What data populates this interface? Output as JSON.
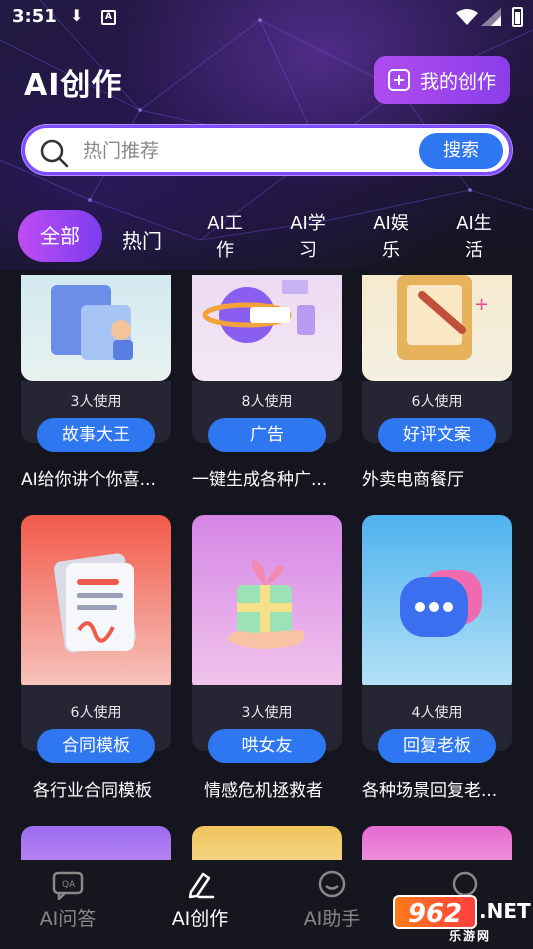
{
  "status_bar": {
    "time": "3:51"
  },
  "header": {
    "title": "AI创作",
    "my_button_label": "我的创作"
  },
  "search": {
    "placeholder": "热门推荐",
    "button_label": "搜索"
  },
  "tabs": [
    {
      "label": "全部",
      "active": true
    },
    {
      "label": "热门"
    },
    {
      "line1": "AI工",
      "line2": "作"
    },
    {
      "line1": "AI学",
      "line2": "习"
    },
    {
      "line1": "AI娱",
      "line2": "乐"
    },
    {
      "line1": "AI生",
      "line2": "活"
    }
  ],
  "cards": [
    {
      "usage": "3人使用",
      "tag": "故事大王",
      "desc": "AI给你讲个你喜...",
      "colors": [
        "#c9e6f0",
        "#e8f2f0"
      ]
    },
    {
      "usage": "8人使用",
      "tag": "广告",
      "desc": "一键生成各种广...",
      "colors": [
        "#e9d4f2",
        "#f4e8f4"
      ]
    },
    {
      "usage": "6人使用",
      "tag": "好评文案",
      "desc": "外卖电商餐厅",
      "colors": [
        "#f6e7c6",
        "#f4f0e2"
      ]
    },
    {
      "usage": "6人使用",
      "tag": "合同模板",
      "desc": "各行业合同模板",
      "colors": [
        "#f25a4a",
        "#f6c7c0"
      ]
    },
    {
      "usage": "3人使用",
      "tag": "哄女友",
      "desc": "情感危机拯救者",
      "colors": [
        "#d586e6",
        "#f2c6ec"
      ]
    },
    {
      "usage": "4人使用",
      "tag": "回复老板",
      "desc": "各种场景回复老...",
      "colors": [
        "#4fb2ee",
        "#b8e3f6"
      ]
    }
  ],
  "bottom_nav": [
    {
      "label": "AI问答"
    },
    {
      "label": "AI创作",
      "active": true
    },
    {
      "label": "AI助手"
    },
    {
      "label": ""
    }
  ],
  "watermark": {
    "logo": "962",
    "suffix": ".NET",
    "sub": "乐游网"
  },
  "accent": {
    "blue": "#2f77f1",
    "purple": "#9b45ef"
  }
}
